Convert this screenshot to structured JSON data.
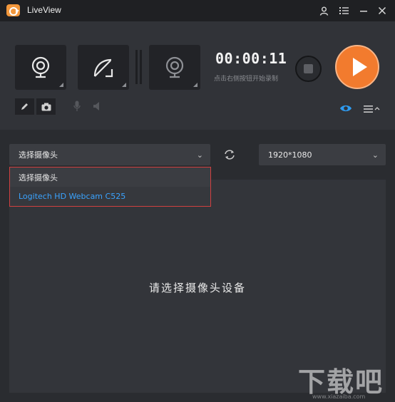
{
  "app": {
    "title": "LiveView"
  },
  "recording": {
    "timer": "00:00:11",
    "hint": "点击右侧按钮开始录制"
  },
  "camera_select": {
    "value": "选择摄像头",
    "options": [
      "选择摄像头",
      "Logitech HD Webcam C525"
    ]
  },
  "resolution_select": {
    "value": "1920*1080"
  },
  "preview": {
    "message": "请选择摄像头设备"
  },
  "watermark": {
    "brand": "下载吧",
    "url": "www.xiazaiba.com"
  },
  "colors": {
    "accent": "#f27b2e",
    "link": "#3aa3ff",
    "highlight_border": "#d14040"
  }
}
